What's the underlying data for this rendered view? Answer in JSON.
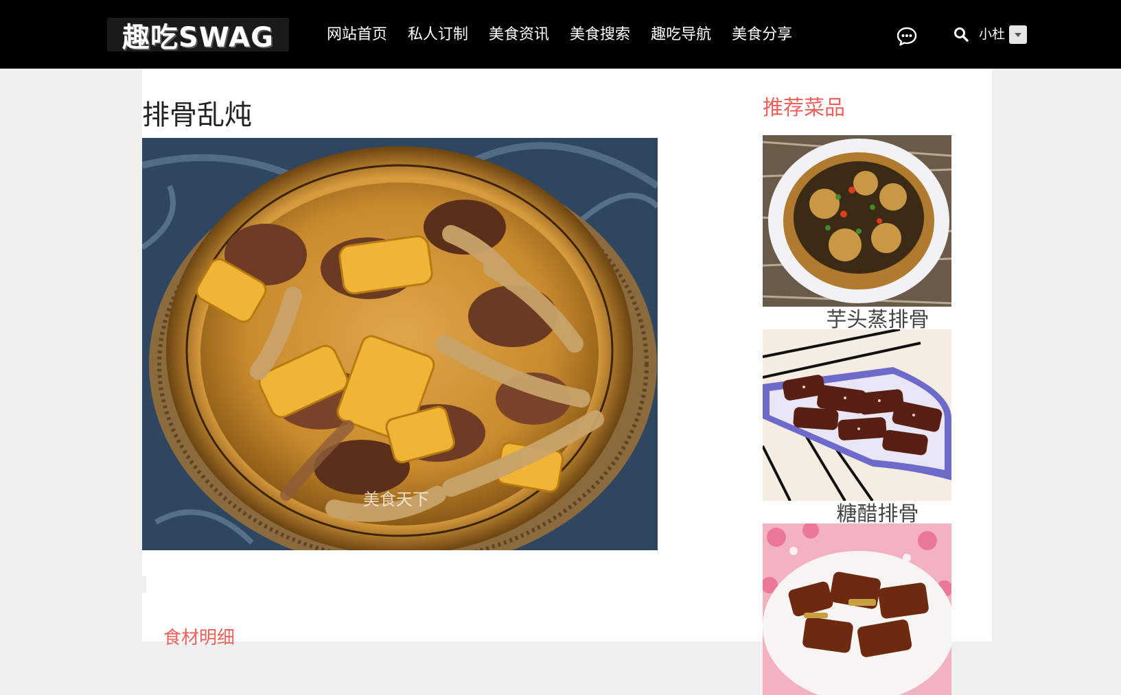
{
  "logo": {
    "text": "趣吃SWAG"
  },
  "nav": {
    "items": [
      {
        "label": "网站首页"
      },
      {
        "label": "私人订制"
      },
      {
        "label": "美食资讯"
      },
      {
        "label": "美食搜索"
      },
      {
        "label": "趣吃导航"
      },
      {
        "label": "美食分享"
      }
    ]
  },
  "user": {
    "name": "小杜"
  },
  "icons": {
    "messages": "chat-bubble-icon",
    "search": "search-icon",
    "dropdown": "chevron-down-icon"
  },
  "main": {
    "dish_title": "排骨乱炖",
    "watermark": "美食天下",
    "ingredients_heading": "食材明细"
  },
  "sidebar": {
    "heading": "推荐菜品",
    "items": [
      {
        "name": "芋头蒸排骨"
      },
      {
        "name": "糖醋排骨"
      },
      {
        "name": ""
      }
    ]
  },
  "colors": {
    "topbar": "#000000",
    "accent": "#f0605a",
    "page_bg": "#f0f0f0"
  }
}
